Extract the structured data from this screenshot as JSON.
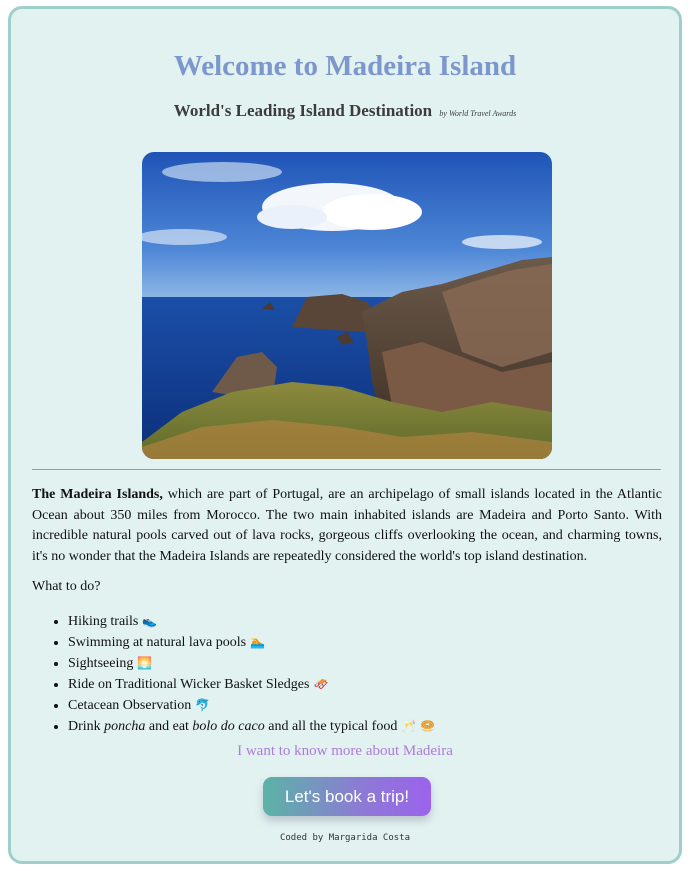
{
  "header": {
    "title": "Welcome to Madeira Island",
    "subtitle": "World's Leading Island Destination",
    "award_note": "by World Travel Awards"
  },
  "photo": {
    "description_icon": "coastal-cliffs-photo"
  },
  "intro": {
    "lead": "The Madeira Islands,",
    "text": " which are part of Portugal, are an archipelago of small islands located in the Atlantic Ocean about 350 miles from Morocco. The two main inhabited islands are Madeira and Porto Santo. With incredible natural pools carved out of lava rocks, gorgeous cliffs overlooking the ocean, and charming towns, it's no wonder that the Madeira Islands are repeatedly considered the world's top island destination."
  },
  "activities": {
    "heading": "What to do?",
    "items": [
      {
        "label": "Hiking trails",
        "emoji": "👟"
      },
      {
        "label": "Swimming at natural lava pools",
        "emoji": "🏊"
      },
      {
        "label": "Sightseeing",
        "emoji": "🌅"
      },
      {
        "label": "Ride on Traditional Wicker Basket Sledges",
        "emoji": "🛷"
      },
      {
        "label": "Cetacean Observation",
        "emoji": "🐬"
      }
    ],
    "last": {
      "pre": "Drink ",
      "drink": "poncha",
      "mid": " and eat ",
      "food": "bolo do caco",
      "post": " and all the typical food",
      "emoji": "🥂 🥯"
    }
  },
  "links": {
    "more": "I want to know more about Madeira"
  },
  "cta": {
    "book_label": "Let's book a trip!"
  },
  "footer": {
    "credit": "Coded by Margarida Costa"
  }
}
